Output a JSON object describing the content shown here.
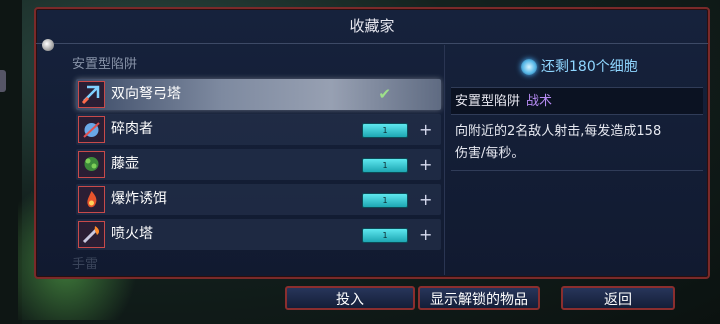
{
  "window": {
    "title": "收藏家"
  },
  "list": {
    "category_top": "安置型陷阱",
    "category_next": "手雷",
    "items": [
      {
        "name": "双向弩弓塔",
        "count": "",
        "selected": true,
        "icon": "crossbow-turret-icon"
      },
      {
        "name": "碎肉者",
        "count": "1",
        "selected": false,
        "icon": "grinder-trap-icon"
      },
      {
        "name": "藤壶",
        "count": "1",
        "selected": false,
        "icon": "barnacle-icon"
      },
      {
        "name": "爆炸诱饵",
        "count": "1",
        "selected": false,
        "icon": "explosive-decoy-icon"
      },
      {
        "name": "喷火塔",
        "count": "1",
        "selected": false,
        "icon": "flamethrower-turret-icon"
      }
    ],
    "check_symbol": "✔",
    "plus_symbol": "+"
  },
  "detail": {
    "cells_remaining": "还剩180个细胞",
    "type_label": "安置型陷阱",
    "category_tag": "战术",
    "description_line1": "向附近的2名敌人射击,每发造成158",
    "description_line2": "伤害/每秒。"
  },
  "buttons": {
    "invest": "投入",
    "show_unlocked": "显示解锁的物品",
    "back": "返回"
  },
  "colors": {
    "accent_border": "#8a2e2e",
    "cell_blue": "#8fd6ff",
    "tag_purple": "#b58af2"
  }
}
